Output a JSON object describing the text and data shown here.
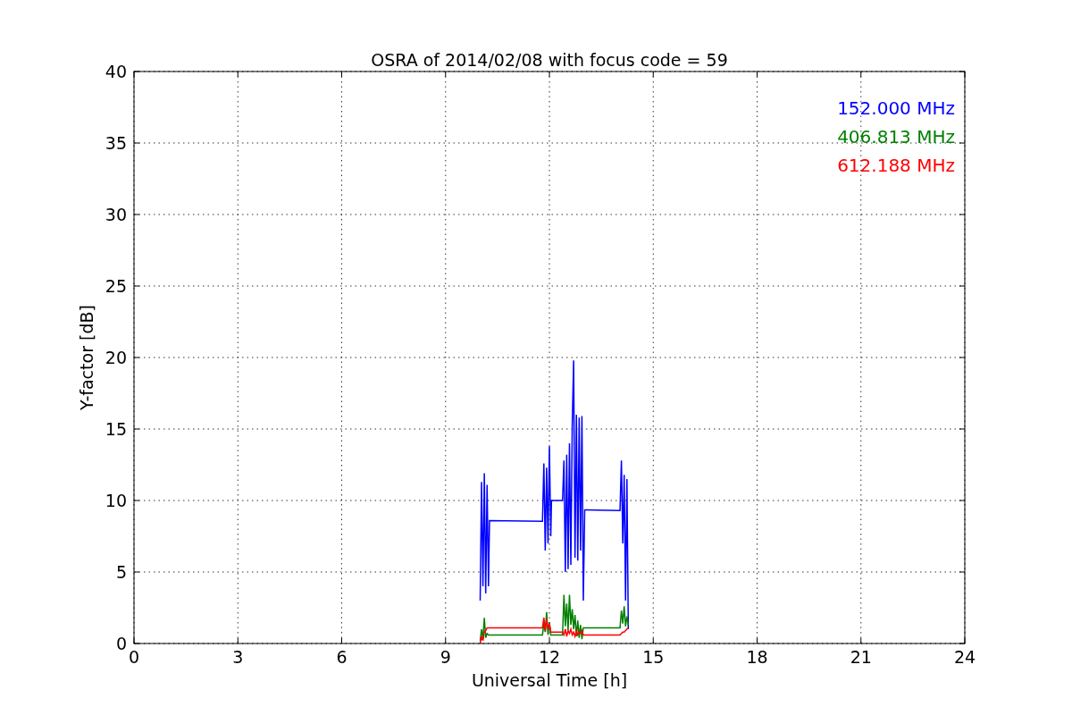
{
  "chart_data": {
    "type": "line",
    "title": "OSRA of 2014/02/08 with focus code = 59",
    "xlabel": "Universal Time [h]",
    "ylabel": "Y-factor [dB]",
    "x": [
      10.0,
      10.04,
      10.08,
      10.12,
      10.16,
      10.2,
      10.24,
      10.27,
      11.8,
      11.84,
      11.88,
      11.92,
      11.96,
      12.0,
      12.04,
      12.06,
      12.38,
      12.42,
      12.46,
      12.5,
      12.54,
      12.58,
      12.62,
      12.66,
      12.7,
      12.74,
      12.78,
      12.82,
      12.86,
      12.9,
      12.94,
      12.98,
      13.02,
      13.05,
      14.04,
      14.08,
      14.12,
      14.16,
      14.2,
      14.24,
      14.28
    ],
    "series": [
      {
        "name": "152.000 MHz",
        "color": "#0000ff",
        "values": [
          3,
          11.3,
          4,
          11.9,
          3.5,
          11.1,
          4,
          8.6,
          8.55,
          12.6,
          6.5,
          12.3,
          7,
          13.8,
          7.5,
          10,
          10,
          12.8,
          5,
          13.2,
          5.2,
          14,
          5.5,
          15.3,
          19.8,
          6,
          16,
          5.8,
          15.8,
          6.5,
          15.9,
          3,
          9.35,
          9.35,
          9.3,
          12.8,
          7,
          11.8,
          3,
          11.5,
          1
        ]
      },
      {
        "name": "406.813 MHz",
        "color": "#008000",
        "values": [
          0.2,
          1.0,
          0.3,
          1.8,
          0.4,
          0.7,
          0.6,
          0.6,
          0.6,
          1.4,
          0.8,
          2.2,
          0.6,
          1.5,
          0.6,
          0.6,
          0.6,
          3.4,
          1.2,
          2.8,
          0.9,
          3.4,
          1.3,
          2.4,
          1.0,
          2.0,
          0.5,
          1.6,
          0.4,
          1.3,
          0.3,
          1.1,
          1.1,
          1.1,
          1.1,
          2.3,
          1.4,
          2.6,
          1.2,
          1.9,
          1.3
        ]
      },
      {
        "name": "612.188 MHz",
        "color": "#ff0000",
        "values": [
          0,
          0.5,
          0.2,
          0.8,
          0.9,
          1.1,
          1.1,
          1.1,
          1.1,
          1.8,
          0.9,
          1.7,
          1.0,
          1.4,
          0.8,
          0.8,
          0.8,
          0.6,
          1.0,
          0.5,
          0.9,
          0.7,
          1.0,
          0.6,
          0.8,
          0.5,
          0.9,
          0.6,
          0.8,
          0.7,
          0.9,
          0.6,
          0.6,
          0.6,
          0.6,
          0.7,
          0.8,
          0.8,
          0.9,
          1.0,
          1.1
        ]
      }
    ],
    "xlim": [
      0,
      24
    ],
    "ylim": [
      0,
      40
    ],
    "xticks": [
      0,
      3,
      6,
      9,
      12,
      15,
      18,
      21,
      24
    ],
    "yticks": [
      0,
      5,
      10,
      15,
      20,
      25,
      30,
      35,
      40
    ],
    "grid": true
  }
}
